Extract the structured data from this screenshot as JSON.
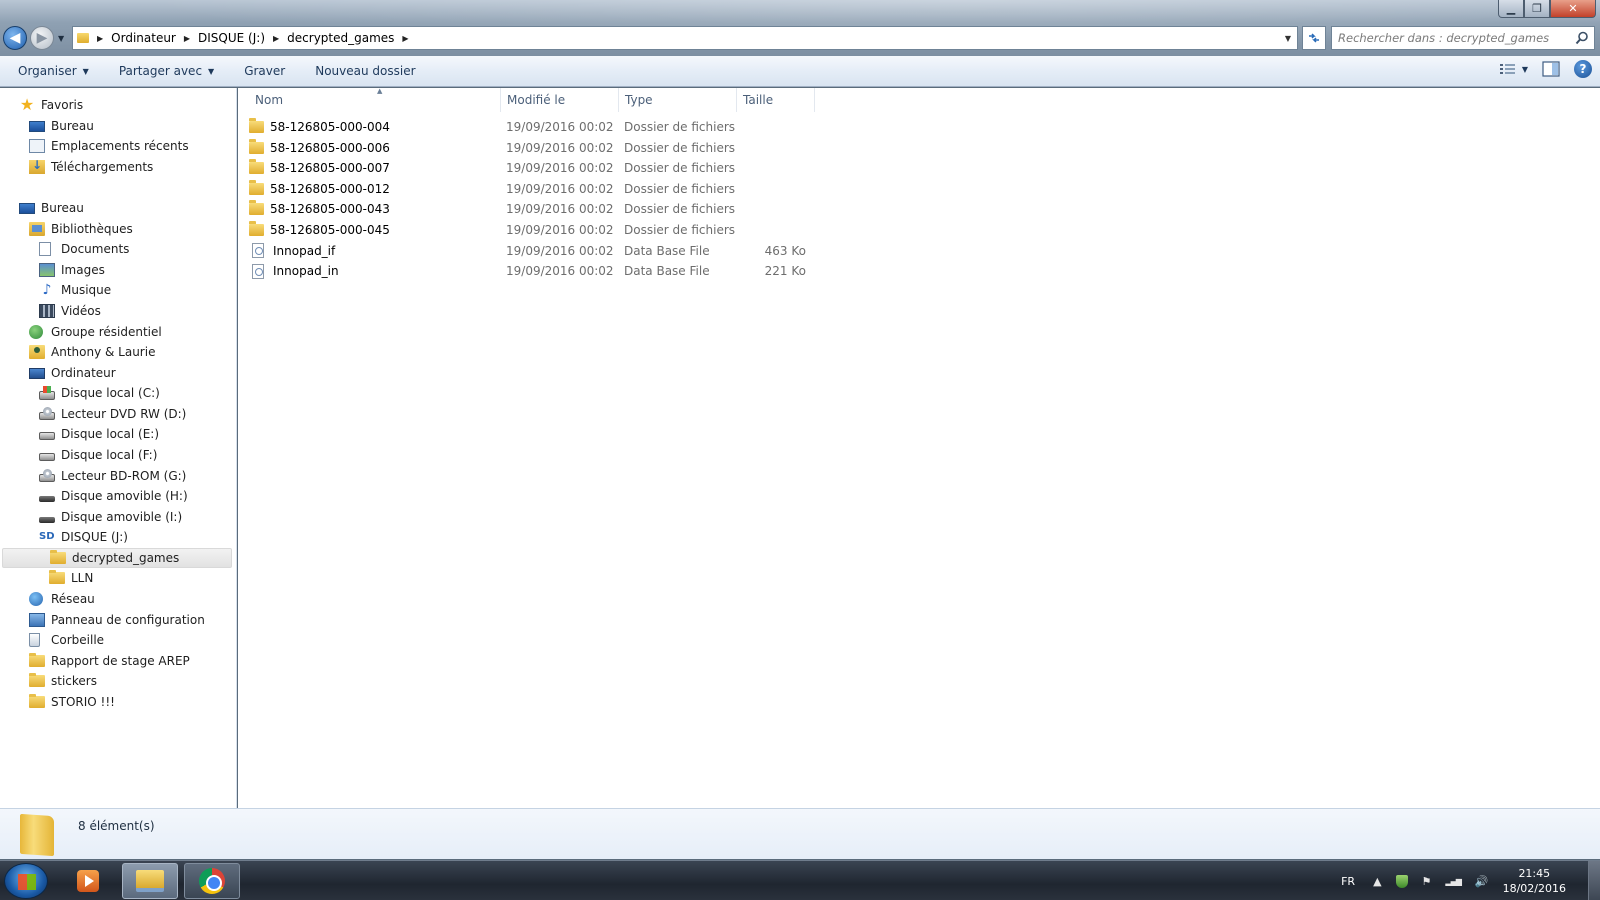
{
  "window": {
    "caption_buttons": {
      "minimize": "▁",
      "maximize": "❐",
      "close": "✕"
    }
  },
  "nav": {
    "back": "◀",
    "forward": "▶",
    "dropdown": "▼"
  },
  "address": {
    "crumbs": [
      "Ordinateur",
      "DISQUE (J:)",
      "decrypted_games"
    ],
    "separator": "▶"
  },
  "search": {
    "placeholder": "Rechercher dans : decrypted_games"
  },
  "toolbar": {
    "organize": "Organiser",
    "share": "Partager avec",
    "burn": "Graver",
    "new_folder": "Nouveau dossier",
    "help": "?"
  },
  "sidebar": {
    "items": [
      {
        "label": "Favoris",
        "icon": "star-icon"
      },
      {
        "label": "Bureau",
        "icon": "desktop-icon"
      },
      {
        "label": "Emplacements récents",
        "icon": "recent-places-icon"
      },
      {
        "label": "Téléchargements",
        "icon": "downloads-icon"
      },
      {
        "label": "Bureau",
        "icon": "desktop-icon"
      },
      {
        "label": "Bibliothèques",
        "icon": "libraries-icon"
      },
      {
        "label": "Documents",
        "icon": "documents-icon"
      },
      {
        "label": "Images",
        "icon": "pictures-icon"
      },
      {
        "label": "Musique",
        "icon": "music-icon"
      },
      {
        "label": "Vidéos",
        "icon": "videos-icon"
      },
      {
        "label": "Groupe résidentiel",
        "icon": "homegroup-icon"
      },
      {
        "label": "Anthony & Laurie",
        "icon": "user-folder-icon"
      },
      {
        "label": "Ordinateur",
        "icon": "computer-icon"
      },
      {
        "label": "Disque local (C:)",
        "icon": "windows-drive-icon"
      },
      {
        "label": "Lecteur DVD RW (D:)",
        "icon": "dvd-drive-icon"
      },
      {
        "label": "Disque local (E:)",
        "icon": "hard-drive-icon"
      },
      {
        "label": "Disque local (F:)",
        "icon": "hard-drive-icon"
      },
      {
        "label": "Lecteur BD-ROM (G:)",
        "icon": "bd-drive-icon"
      },
      {
        "label": "Disque amovible (H:)",
        "icon": "removable-drive-icon"
      },
      {
        "label": "Disque amovible (I:)",
        "icon": "removable-drive-icon"
      },
      {
        "label": "DISQUE (J:)",
        "icon": "sd-card-icon"
      },
      {
        "label": "decrypted_games",
        "icon": "folder-icon"
      },
      {
        "label": "LLN",
        "icon": "folder-icon"
      },
      {
        "label": "Réseau",
        "icon": "network-icon"
      },
      {
        "label": "Panneau de configuration",
        "icon": "control-panel-icon"
      },
      {
        "label": "Corbeille",
        "icon": "recycle-bin-icon"
      },
      {
        "label": "Rapport de stage AREP",
        "icon": "folder-icon"
      },
      {
        "label": "stickers",
        "icon": "folder-icon"
      },
      {
        "label": "STORIO !!!",
        "icon": "folder-icon"
      }
    ]
  },
  "columns": {
    "name": "Nom",
    "modified": "Modifié le",
    "type": "Type",
    "size": "Taille"
  },
  "files": [
    {
      "name": "58-126805-000-004",
      "modified": "19/09/2016 00:02",
      "type": "Dossier de fichiers",
      "size": "",
      "kind": "folder"
    },
    {
      "name": "58-126805-000-006",
      "modified": "19/09/2016 00:02",
      "type": "Dossier de fichiers",
      "size": "",
      "kind": "folder"
    },
    {
      "name": "58-126805-000-007",
      "modified": "19/09/2016 00:02",
      "type": "Dossier de fichiers",
      "size": "",
      "kind": "folder"
    },
    {
      "name": "58-126805-000-012",
      "modified": "19/09/2016 00:02",
      "type": "Dossier de fichiers",
      "size": "",
      "kind": "folder"
    },
    {
      "name": "58-126805-000-043",
      "modified": "19/09/2016 00:02",
      "type": "Dossier de fichiers",
      "size": "",
      "kind": "folder"
    },
    {
      "name": "58-126805-000-045",
      "modified": "19/09/2016 00:02",
      "type": "Dossier de fichiers",
      "size": "",
      "kind": "folder"
    },
    {
      "name": "Innopad_if",
      "modified": "19/09/2016 00:02",
      "type": "Data Base File",
      "size": "463 Ko",
      "kind": "file"
    },
    {
      "name": "Innopad_in",
      "modified": "19/09/2016 00:02",
      "type": "Data Base File",
      "size": "221 Ko",
      "kind": "file"
    }
  ],
  "status": {
    "count": "8 élément(s)"
  },
  "taskbar": {
    "language": "FR",
    "time": "21:45",
    "date": "18/02/2016",
    "tray_icons": {
      "show_hidden": "▲",
      "flag": "⚑",
      "signal": "▂▄▆",
      "volume": "🔊"
    }
  },
  "colors": {
    "accent": "#1e395b",
    "selected_bg": "#e5e5e5"
  }
}
